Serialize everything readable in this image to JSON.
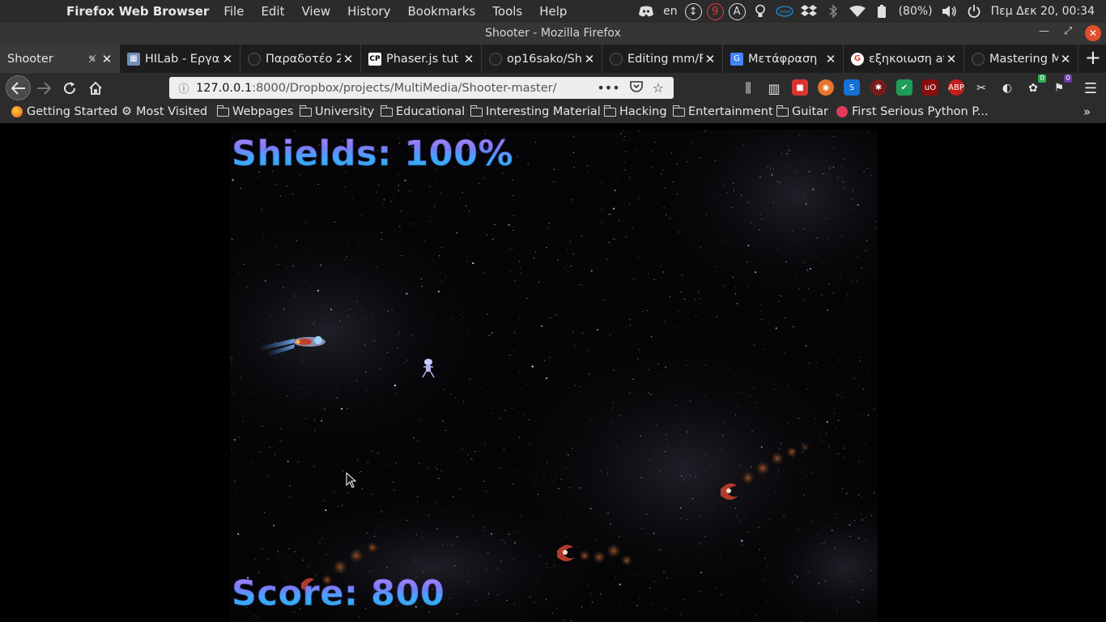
{
  "system_bar": {
    "app_title": "Firefox Web Browser",
    "menu": [
      "File",
      "Edit",
      "View",
      "History",
      "Bookmarks",
      "Tools",
      "Help"
    ],
    "keyboard_layout": "en",
    "notification_count": "9",
    "a_indicator": "A",
    "battery": "(80%)",
    "datetime": "Πεμ Δεκ 20, 00:34"
  },
  "window": {
    "title": "Shooter - Mozilla Firefox"
  },
  "tabs": [
    {
      "label": "Shooter",
      "active": true,
      "favicon": "none"
    },
    {
      "label": "HILab - Εργα",
      "favicon": "image"
    },
    {
      "label": "Παραδοτέο 2",
      "favicon": "github"
    },
    {
      "label": "Phaser.js tut",
      "favicon": "cp"
    },
    {
      "label": "op16sako/Sho",
      "favicon": "github"
    },
    {
      "label": "Editing mm/F",
      "favicon": "github"
    },
    {
      "label": "Μετάφραση",
      "favicon": "translate"
    },
    {
      "label": "εξηκοιωση at",
      "favicon": "google"
    },
    {
      "label": "Mastering M",
      "favicon": "github"
    }
  ],
  "navbar": {
    "url_host": "127.0.0.1",
    "url_path": ":8000/Dropbox/projects/MultiMedia/Shooter-master/",
    "ext_badges": {
      "green": "0",
      "purple": "0"
    }
  },
  "bookmarks": [
    {
      "label": "Getting Started",
      "icon": "firefox"
    },
    {
      "label": "Most Visited",
      "icon": "gear"
    },
    {
      "label": "Webpages",
      "icon": "folder"
    },
    {
      "label": "University",
      "icon": "folder"
    },
    {
      "label": "Educational",
      "icon": "folder"
    },
    {
      "label": "Interesting Material",
      "icon": "folder"
    },
    {
      "label": "Hacking",
      "icon": "folder"
    },
    {
      "label": "Entertainment",
      "icon": "folder"
    },
    {
      "label": "Guitar",
      "icon": "folder"
    },
    {
      "label": "First Serious Python P...",
      "icon": "pocket"
    }
  ],
  "game": {
    "shields_label": "Shields: 100%",
    "score_label": "Score: 800",
    "hud_gradient": [
      "#b58cff",
      "#40a8ff"
    ]
  }
}
